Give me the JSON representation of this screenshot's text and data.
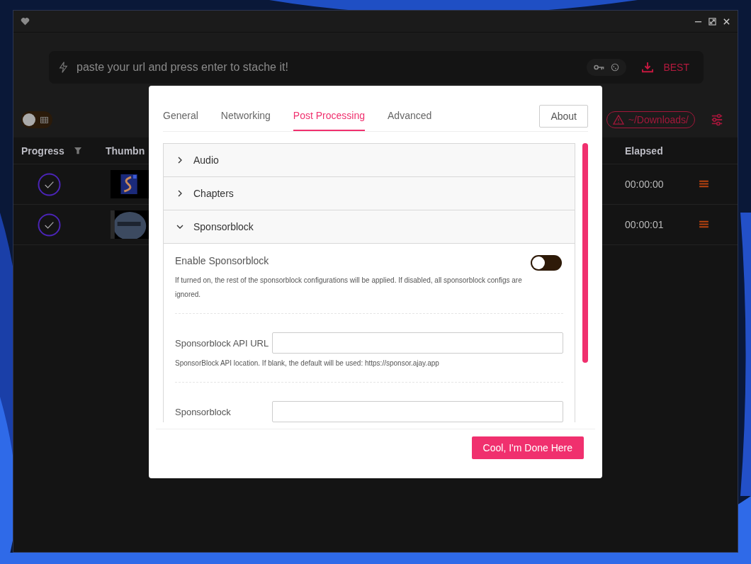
{
  "url_bar": {
    "placeholder": "paste your url and press enter to stache it!",
    "quality": "BEST"
  },
  "toolbar": {
    "view_toggle": {
      "on": false
    },
    "download_path": "~/Downloads/"
  },
  "table": {
    "columns": [
      "Progress",
      "Thumbn",
      "Elapsed"
    ],
    "rows": [
      {
        "elapsed": "00:00:00"
      },
      {
        "elapsed": "00:00:01"
      }
    ]
  },
  "settings": {
    "tabs": [
      {
        "label": "General",
        "selected": false
      },
      {
        "label": "Networking",
        "selected": false
      },
      {
        "label": "Post Processing",
        "selected": true
      },
      {
        "label": "Advanced",
        "selected": false
      }
    ],
    "about": "About",
    "sections": [
      {
        "title": "Audio",
        "expanded": false
      },
      {
        "title": "Chapters",
        "expanded": false
      },
      {
        "title": "Sponsorblock",
        "expanded": true
      }
    ],
    "fields": [
      {
        "kind": "toggle",
        "label": "Enable Sponsorblock",
        "on": false,
        "help": "If turned on, the rest of the sponsorblock configurations will be applied. If disabled, all sponsorblock configs are ignored."
      },
      {
        "kind": "text",
        "label": "Sponsorblock API URL",
        "help": "SponsorBlock API location. If blank, the default will be used: https://sponsor.ajay.app"
      },
      {
        "kind": "text",
        "label": "Sponsorblock"
      }
    ],
    "done": "Cool, I'm Done Here"
  }
}
